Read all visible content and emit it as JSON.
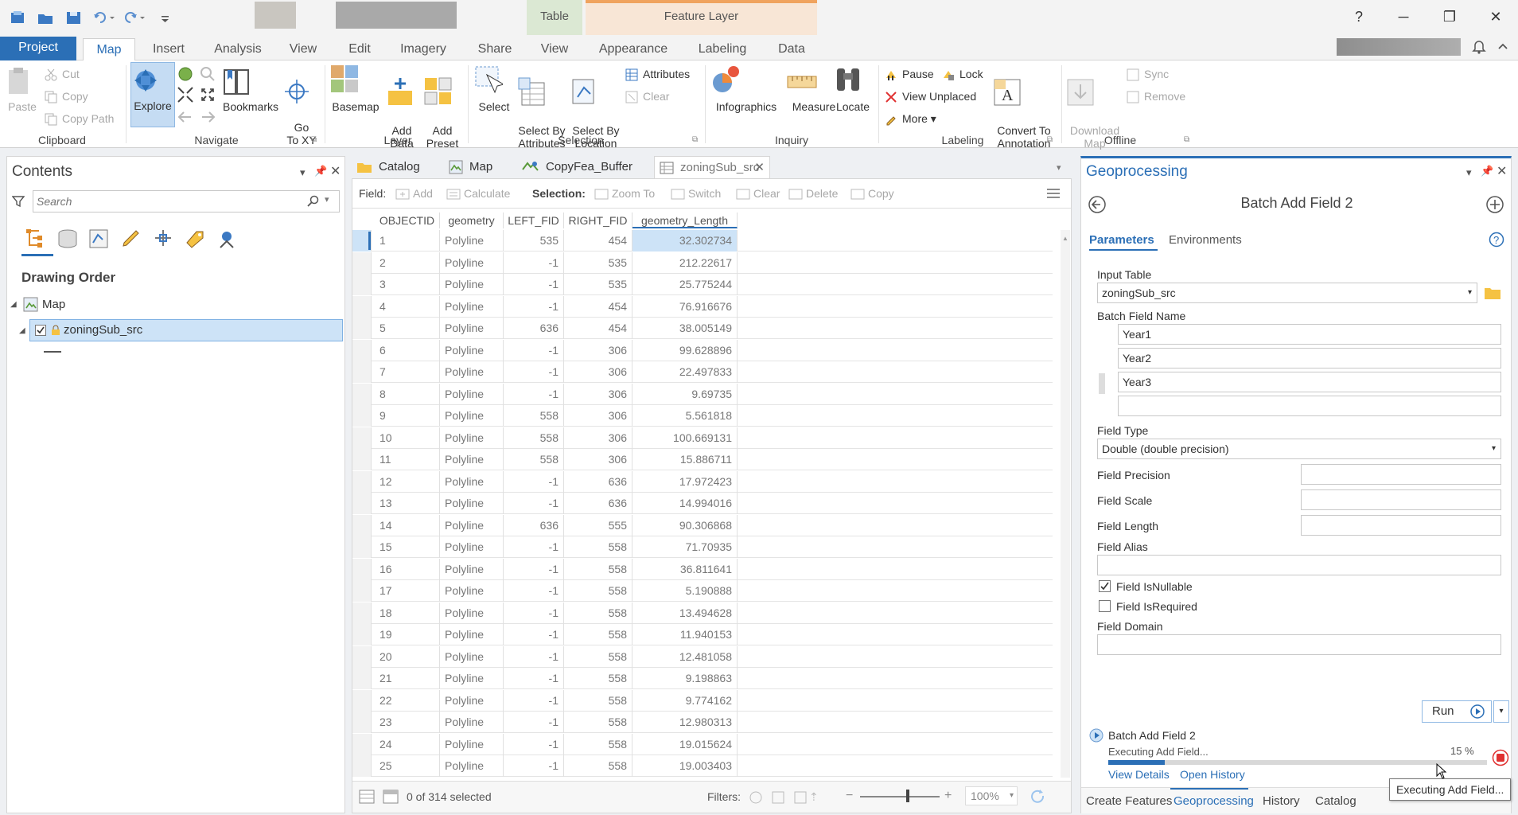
{
  "contextual_tabs": {
    "table": "Table",
    "feature_layer": "Feature Layer"
  },
  "window": {
    "help": "?",
    "minimize": "─",
    "restore": "❐",
    "close": "✕"
  },
  "tabs": [
    "Project",
    "Map",
    "Insert",
    "Analysis",
    "View",
    "Edit",
    "Imagery",
    "Share",
    "View",
    "Appearance",
    "Labeling",
    "Data"
  ],
  "ribbon": {
    "clipboard": {
      "label": "Clipboard",
      "paste": "Paste",
      "cut": "Cut",
      "copy": "Copy",
      "copy_path": "Copy Path"
    },
    "navigate": {
      "label": "Navigate",
      "explore": "Explore",
      "bookmarks": "Bookmarks",
      "goto": "Go\nTo XY"
    },
    "layer": {
      "label": "Layer",
      "basemap": "Basemap",
      "add_data": "Add\nData",
      "add_preset": "Add\nPreset"
    },
    "selection": {
      "label": "Selection",
      "select": "Select",
      "select_by_attributes": "Select By\nAttributes",
      "select_by_location": "Select By\nLocation",
      "attributes": "Attributes",
      "clear": "Clear"
    },
    "inquiry": {
      "label": "Inquiry",
      "infographics": "Infographics",
      "measure": "Measure",
      "locate": "Locate"
    },
    "labeling": {
      "label": "Labeling",
      "pause": "Pause",
      "lock": "Lock",
      "view_unplaced": "View Unplaced",
      "more": "More",
      "convert": "Convert To\nAnnotation"
    },
    "offline": {
      "label": "Offline",
      "download_map": "Download\nMap",
      "sync": "Sync",
      "remove": "Remove"
    }
  },
  "contents": {
    "title": "Contents",
    "search_placeholder": "Search",
    "drawing_order": "Drawing Order",
    "map_node": "Map",
    "layer_node": "zoningSub_src"
  },
  "doc_tabs": [
    "Catalog",
    "Map",
    "CopyFea_Buffer",
    "zoningSub_src"
  ],
  "table_toolbar": {
    "field_label": "Field:",
    "add": "Add",
    "calculate": "Calculate",
    "selection_label": "Selection:",
    "zoom_to": "Zoom To",
    "switch": "Switch",
    "clear": "Clear",
    "delete": "Delete",
    "copy": "Copy"
  },
  "table": {
    "columns": [
      "OBJECTID",
      "geometry",
      "LEFT_FID",
      "RIGHT_FID",
      "geometry_Length"
    ],
    "rows": [
      [
        "1",
        "Polyline",
        "535",
        "454",
        "32.302734"
      ],
      [
        "2",
        "Polyline",
        "-1",
        "535",
        "212.22617"
      ],
      [
        "3",
        "Polyline",
        "-1",
        "535",
        "25.775244"
      ],
      [
        "4",
        "Polyline",
        "-1",
        "454",
        "76.916676"
      ],
      [
        "5",
        "Polyline",
        "636",
        "454",
        "38.005149"
      ],
      [
        "6",
        "Polyline",
        "-1",
        "306",
        "99.628896"
      ],
      [
        "7",
        "Polyline",
        "-1",
        "306",
        "22.497833"
      ],
      [
        "8",
        "Polyline",
        "-1",
        "306",
        "9.69735"
      ],
      [
        "9",
        "Polyline",
        "558",
        "306",
        "5.561818"
      ],
      [
        "10",
        "Polyline",
        "558",
        "306",
        "100.669131"
      ],
      [
        "11",
        "Polyline",
        "558",
        "306",
        "15.886711"
      ],
      [
        "12",
        "Polyline",
        "-1",
        "636",
        "17.972423"
      ],
      [
        "13",
        "Polyline",
        "-1",
        "636",
        "14.994016"
      ],
      [
        "14",
        "Polyline",
        "636",
        "555",
        "90.306868"
      ],
      [
        "15",
        "Polyline",
        "-1",
        "558",
        "71.70935"
      ],
      [
        "16",
        "Polyline",
        "-1",
        "558",
        "36.811641"
      ],
      [
        "17",
        "Polyline",
        "-1",
        "558",
        "5.190888"
      ],
      [
        "18",
        "Polyline",
        "-1",
        "558",
        "13.494628"
      ],
      [
        "19",
        "Polyline",
        "-1",
        "558",
        "11.940153"
      ],
      [
        "20",
        "Polyline",
        "-1",
        "558",
        "12.481058"
      ],
      [
        "21",
        "Polyline",
        "-1",
        "558",
        "9.198863"
      ],
      [
        "22",
        "Polyline",
        "-1",
        "558",
        "9.774162"
      ],
      [
        "23",
        "Polyline",
        "-1",
        "558",
        "12.980313"
      ],
      [
        "24",
        "Polyline",
        "-1",
        "558",
        "19.015624"
      ],
      [
        "25",
        "Polyline",
        "-1",
        "558",
        "19.003403"
      ]
    ],
    "selected_count": "0 of 314 selected",
    "filters_label": "Filters:",
    "zoom": "100%"
  },
  "geoprocessing": {
    "title": "Geoprocessing",
    "tool_name": "Batch Add Field 2",
    "tab_parameters": "Parameters",
    "tab_environments": "Environments",
    "input_table_label": "Input Table",
    "input_table_value": "zoningSub_src",
    "batch_field_label": "Batch Field Name",
    "batch_fields": [
      "Year1",
      "Year2",
      "Year3",
      ""
    ],
    "field_type_label": "Field Type",
    "field_type_value": "Double (double precision)",
    "field_precision_label": "Field Precision",
    "field_scale_label": "Field Scale",
    "field_length_label": "Field Length",
    "field_alias_label": "Field Alias",
    "nullable_label": "Field IsNullable",
    "nullable_checked": true,
    "required_label": "Field IsRequired",
    "required_checked": false,
    "domain_label": "Field Domain",
    "run_label": "Run",
    "progress_tool": "Batch Add Field 2",
    "progress_status": "Executing Add Field...",
    "progress_percent": "15 %",
    "progress_fraction": 0.15,
    "view_details": "View Details",
    "open_history": "Open History",
    "tooltip": "Executing Add Field..."
  },
  "bottom_tabs": [
    "Create Features",
    "Geoprocessing",
    "History",
    "Catalog"
  ],
  "colors": {
    "accent": "#2b6fb6",
    "selected_row": "#cde3f7",
    "stop": "#e03131"
  }
}
